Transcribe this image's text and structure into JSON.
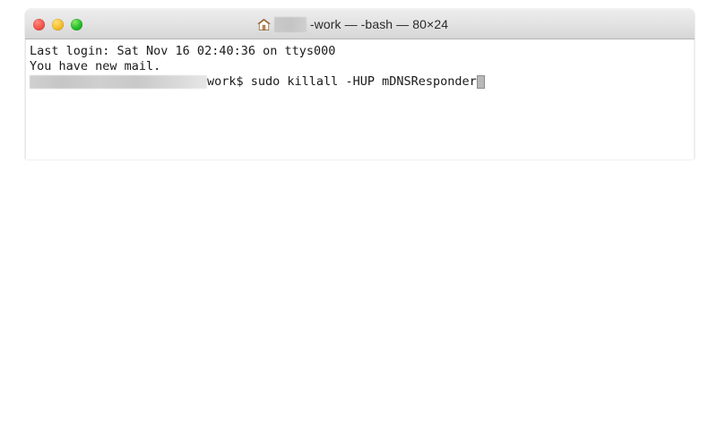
{
  "window": {
    "title_suffix": "-work — -bash — 80×24",
    "redacted_title_label": "redacted-username",
    "icons": {
      "home": "home-icon"
    },
    "traffic_lights": [
      {
        "name": "close-button",
        "label": "Close",
        "color": "#f4544a"
      },
      {
        "name": "minimize-button",
        "label": "Minimize",
        "color": "#f6bf2c"
      },
      {
        "name": "zoom-button",
        "label": "Zoom",
        "color": "#22bd27"
      }
    ],
    "columns": 80,
    "rows": 24
  },
  "terminal": {
    "lines": {
      "last_login": "Last login: Sat Nov 16 02:40:36 on ttys000",
      "mail_notice": "You have new mail.",
      "prompt_suffix": "work$ ",
      "command": "sudo killall -HUP mDNSResponder"
    },
    "redacted_prompt_label": "redacted-host-and-path",
    "cursor": "block-cursor",
    "background": "#ffffff",
    "foreground": "#1a1a1a"
  }
}
